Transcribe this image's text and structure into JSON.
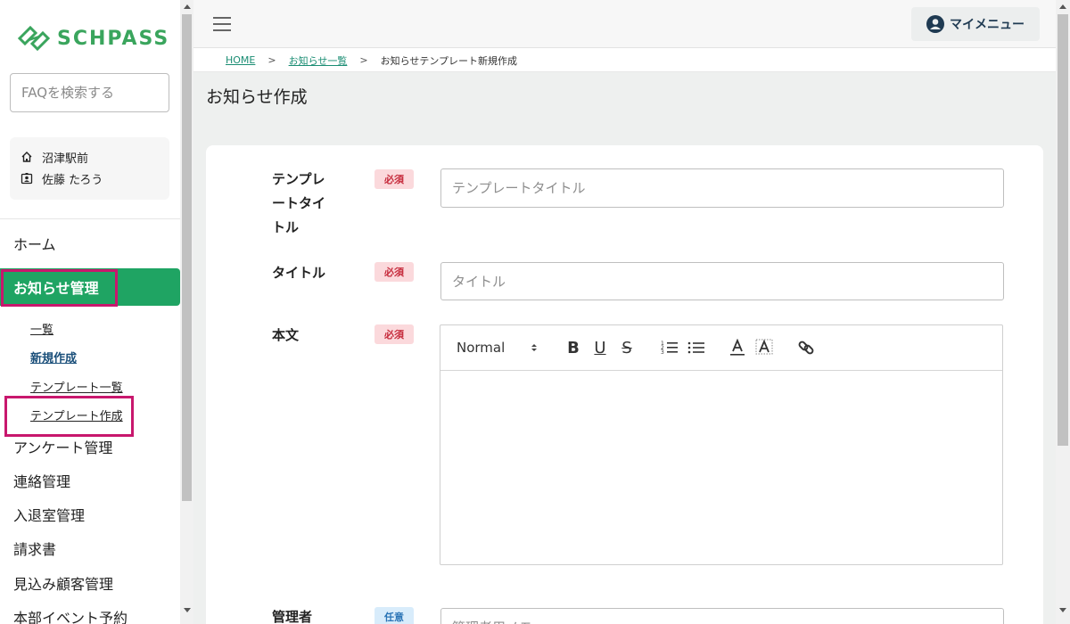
{
  "logo": {
    "text": "SCHPASS"
  },
  "sidebar": {
    "search_placeholder": "FAQを検索する",
    "school": "沼津駅前",
    "user": "佐藤 たろう",
    "nav": {
      "home": "ホーム",
      "news": "お知らせ管理",
      "survey": "アンケート管理",
      "contact": "連絡管理",
      "entry": "入退室管理",
      "invoice": "請求書",
      "prospect": "見込み顧客管理",
      "event": "本部イベント予約"
    },
    "sub": {
      "list": "一覧",
      "new": "新規作成",
      "template_list": "テンプレート一覧",
      "template_create": "テンプレート作成"
    }
  },
  "topbar": {
    "my_menu": "マイメニュー"
  },
  "breadcrumb": {
    "home": "HOME",
    "list": "お知らせ一覧",
    "current": "お知らせテンプレート新規作成",
    "sep": ">"
  },
  "page": {
    "title": "お知らせ作成"
  },
  "form": {
    "template_title": {
      "label_line1": "テンプレ",
      "label_line2": "ートタイ",
      "label_line3": "トル",
      "badge": "必須",
      "placeholder": "テンプレートタイトル"
    },
    "title": {
      "label": "タイトル",
      "badge": "必須",
      "placeholder": "タイトル"
    },
    "body": {
      "label": "本文",
      "badge": "必須",
      "format": "Normal"
    },
    "admin": {
      "label": "管理者",
      "badge": "任意",
      "placeholder": "管理者用メモ"
    }
  },
  "colors": {
    "accent": "#1fa463",
    "highlight": "#c8176d",
    "required": "#c62b3c",
    "optional": "#2a74b6"
  },
  "icons": [
    "logo-icon",
    "home-icon",
    "badge-icon",
    "hamburger-icon",
    "user-circle-icon",
    "ordered-list-icon",
    "bullet-list-icon",
    "text-color-icon",
    "highlight-icon",
    "link-icon"
  ]
}
